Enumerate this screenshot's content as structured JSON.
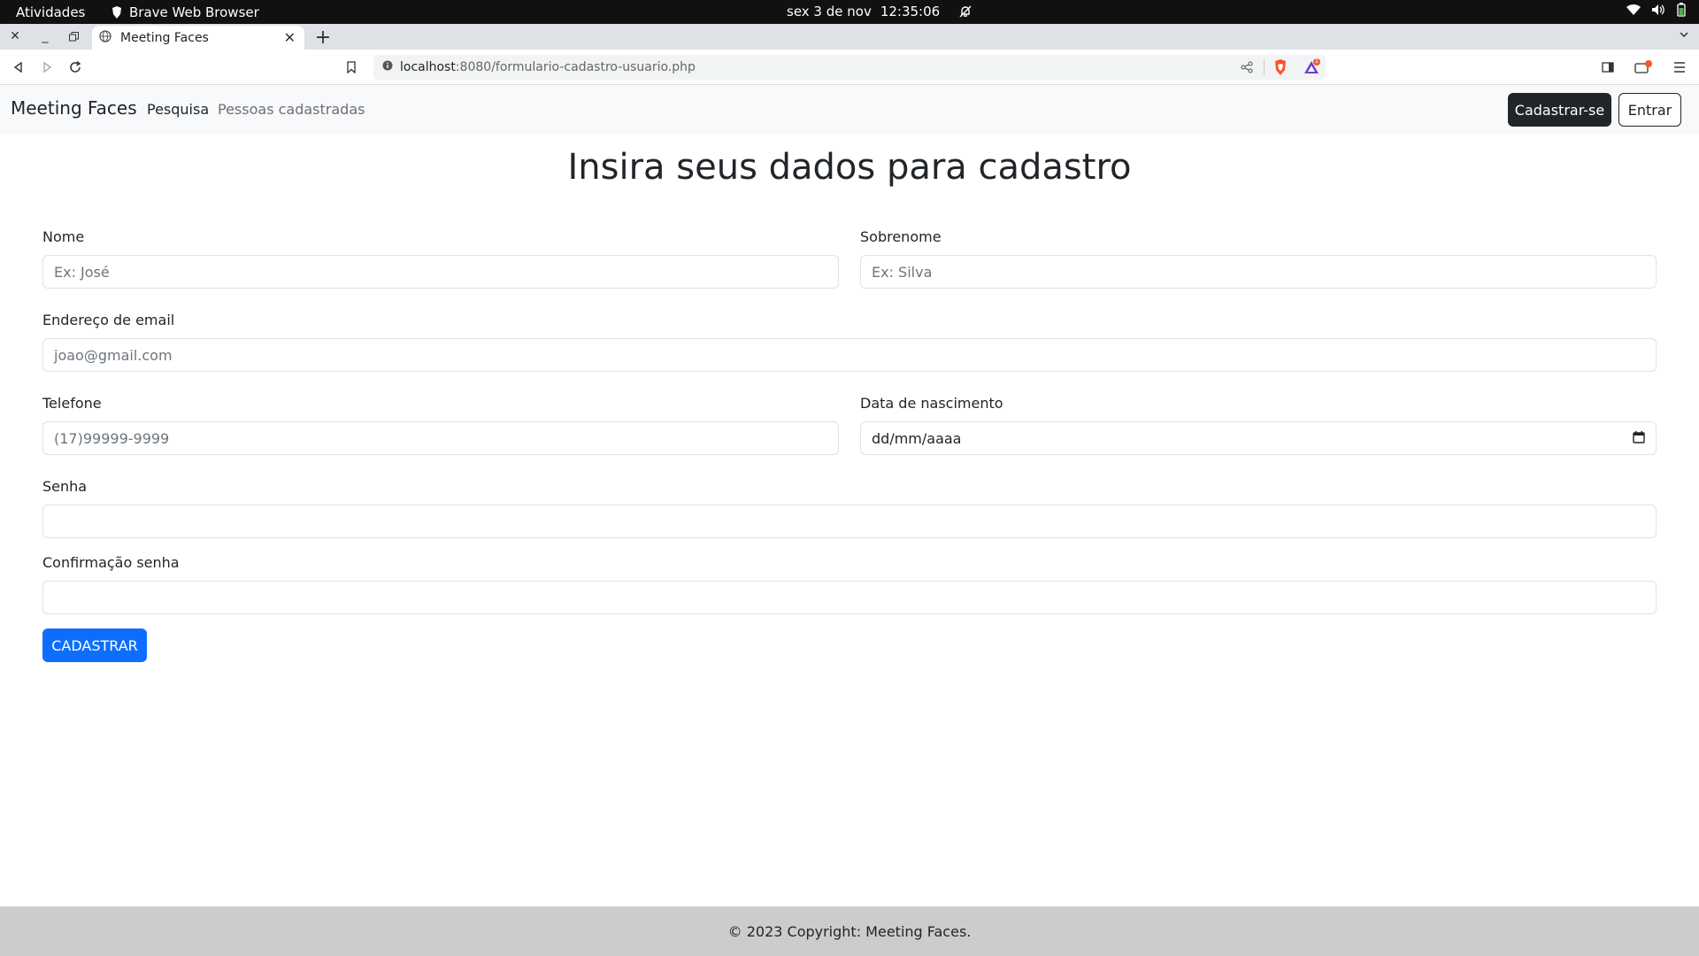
{
  "system_bar": {
    "activities": "Atividades",
    "app_name": "Brave Web Browser",
    "date": "sex 3 de nov",
    "time": "12:35:06"
  },
  "browser": {
    "tab_title": "Meeting Faces",
    "url_host": "localhost",
    "url_path": ":8080/formulario-cadastro-usuario.php",
    "alert_badge": "1"
  },
  "navbar": {
    "brand": "Meeting Faces",
    "links": [
      "Pesquisa",
      "Pessoas cadastradas"
    ],
    "signup_label": "Cadastrar-se",
    "login_label": "Entrar"
  },
  "form": {
    "title": "Insira seus dados para cadastro",
    "first_name": {
      "label": "Nome",
      "placeholder": "Ex: José"
    },
    "last_name": {
      "label": "Sobrenome",
      "placeholder": "Ex: Silva"
    },
    "email": {
      "label": "Endereço de email",
      "placeholder": "joao@gmail.com"
    },
    "phone": {
      "label": "Telefone",
      "placeholder": "(17)99999-9999"
    },
    "birthdate": {
      "label": "Data de nascimento",
      "value": "dd/mm/aaaa"
    },
    "password": {
      "label": "Senha",
      "placeholder": ""
    },
    "password_confirm": {
      "label": "Confirmação senha",
      "placeholder": ""
    },
    "submit_label": "CADASTRAR"
  },
  "footer": {
    "text": "© 2023 Copyright: Meeting Faces."
  },
  "colors": {
    "primary": "#0d6efd",
    "dark": "#212529",
    "footer_bg": "#cccccc",
    "navbar_bg": "#f8f9fa"
  }
}
